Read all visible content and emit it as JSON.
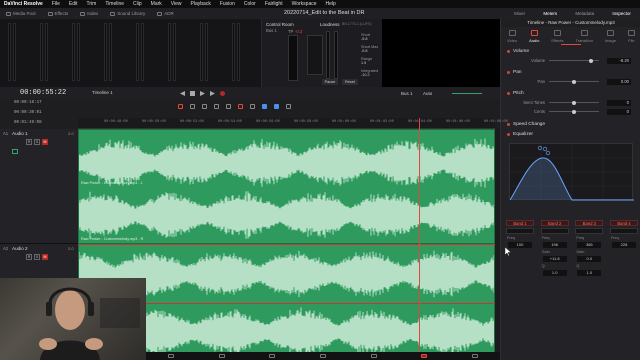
{
  "menubar": {
    "app": "DaVinci Resolve",
    "items": [
      "File",
      "Edit",
      "Trim",
      "Timeline",
      "Clip",
      "Mark",
      "View",
      "Playback",
      "Fusion",
      "Color",
      "Fairlight",
      "Workspace",
      "Help"
    ]
  },
  "toolbar": {
    "items": [
      "Media Pool",
      "Effects",
      "Index",
      "Sound Library",
      "ADR"
    ],
    "project_title": "20220714_Edit to the Beat in DR",
    "right_items": [
      "Mixer",
      "Meters",
      "Metadata",
      "Inspector"
    ]
  },
  "control_room": {
    "label": "Control Room",
    "loudness_label": "Loudness",
    "standard": "BS.1770-1 (LUFS)",
    "tp_label": "TP",
    "tp_value": "-0.3",
    "bus_label": "Bus 1",
    "short": "Short",
    "short_max": "Short Max",
    "range": "Range",
    "integrated": "Integrated",
    "pause_label": "Pause",
    "reset_label": "Reset",
    "short_value": "-9.8",
    "short_max_value": "-9.8",
    "range_value": "1.9",
    "integrated_value": "-10.2"
  },
  "inspector": {
    "title": "Timeline - Raw Power - Custommelody.mp3",
    "tabs": [
      "Video",
      "Audio",
      "Effects",
      "Transition",
      "Image",
      "File"
    ],
    "active_tab": "Audio",
    "volume": {
      "label": "Volume",
      "param": "Volume",
      "value": "-8.20"
    },
    "pan": {
      "label": "Pan",
      "param": "Pan",
      "value": "0.00"
    },
    "pitch": {
      "label": "Pitch",
      "semitones_label": "Semi Tones",
      "semitones_value": "0",
      "cents_label": "Cents",
      "cents_value": "0"
    },
    "speed_change": {
      "label": "Speed Change"
    },
    "equalizer": {
      "label": "Equalizer",
      "bands": [
        {
          "name": "Band 1",
          "freq_label": "Freq",
          "freq": "100"
        },
        {
          "name": "Band 2",
          "freq_label": "Freq",
          "freq": "196",
          "gain_label": "Gain",
          "gain": "+11.8",
          "q_label": "Q",
          "q": "1.0"
        },
        {
          "name": "Band 3",
          "freq_label": "Freq",
          "freq": "365",
          "gain_label": "Gain",
          "gain": "0.0",
          "q_label": "Q",
          "q": "1.0"
        },
        {
          "name": "Band 4",
          "freq_label": "Freq",
          "freq": "228"
        }
      ]
    }
  },
  "timeline": {
    "timecode": "00:00:55:22",
    "name": "Timeline 1",
    "tc_rows": [
      "00:00:10:17",
      "00:00:30:01",
      "00:01:49:08"
    ],
    "bus_label": "Bus 1",
    "auto_label": "Auto",
    "ruler": [
      "00:00:48:00",
      "00:00:50:00",
      "00:00:52:00",
      "00:00:54:00",
      "00:00:56:00",
      "00:00:58:00",
      "00:01:00:00",
      "00:01:02:00",
      "00:01:04:00",
      "00:01:06:00",
      "00:01:08:00"
    ],
    "tracks": [
      {
        "id": "A1",
        "name": "Audio 1",
        "level": "2.0",
        "clip_name": "Raw Power - Custommelody.mp3 - L"
      },
      {
        "id": "A2",
        "name": "Audio 2",
        "level": "2.0",
        "clip_name": "Raw Power - Custommelody.mp3 - R"
      }
    ],
    "track_buttons": [
      "R",
      "S",
      "M"
    ]
  },
  "pages": [
    "media",
    "cut",
    "edit",
    "fusion",
    "color",
    "fairlight",
    "deliver"
  ],
  "active_page": "fairlight",
  "colors": {
    "accent": "#e0483e",
    "clip_green": "#2f9a5d",
    "background": "#1b1b1e"
  }
}
